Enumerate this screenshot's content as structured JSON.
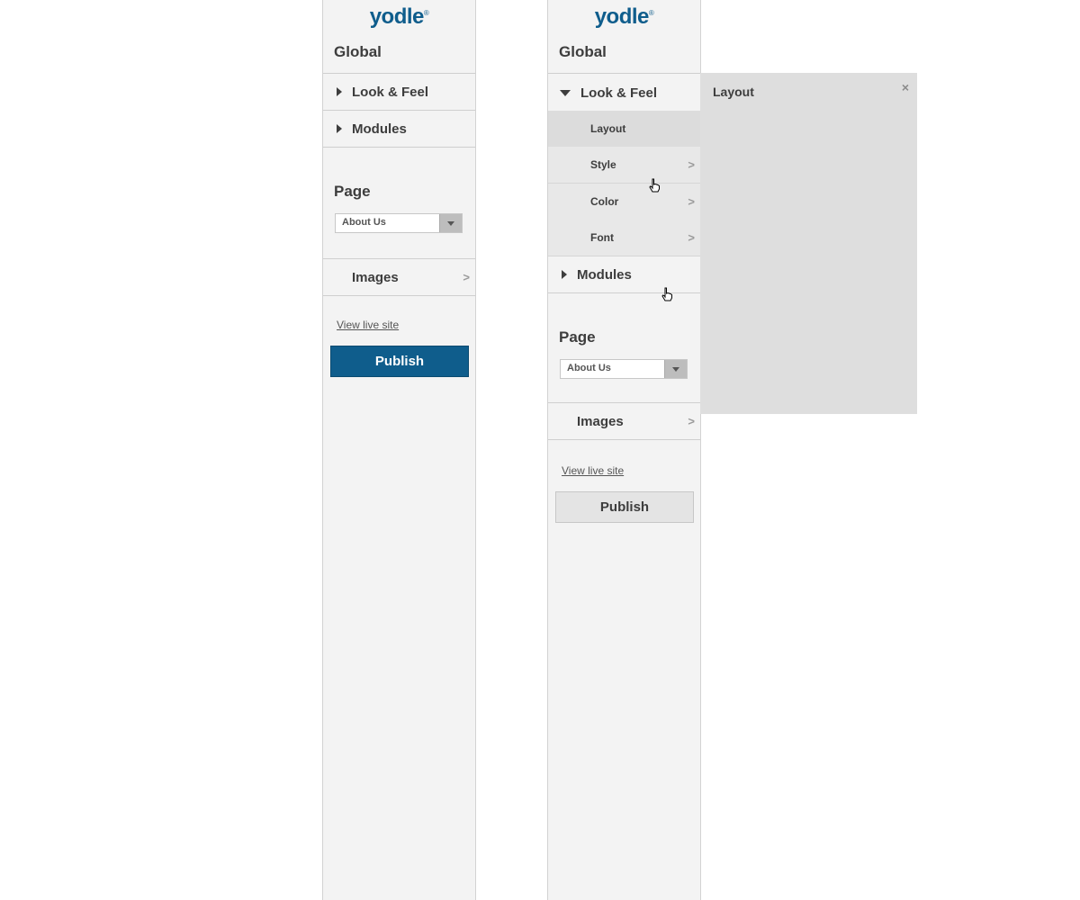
{
  "colors": {
    "brand": "#0f5d8c",
    "sidebar_bg": "#f3f3f3",
    "flyout_bg": "#dedede",
    "text": "#3d3d3d"
  },
  "left_panel": {
    "logo": "yodle",
    "logo_mark": "®",
    "global_label": "Global",
    "sections": [
      {
        "label": "Look & Feel",
        "expanded": false
      },
      {
        "label": "Modules",
        "expanded": false
      }
    ],
    "page_label": "Page",
    "page_select": {
      "value": "About Us"
    },
    "images_label": "Images",
    "view_live_site": "View live site",
    "publish_label": "Publish"
  },
  "right_panel": {
    "logo": "yodle",
    "logo_mark": "®",
    "global_label": "Global",
    "sections": [
      {
        "label": "Look & Feel",
        "expanded": true
      },
      {
        "label": "Modules",
        "expanded": false
      }
    ],
    "look_feel_items": [
      {
        "label": "Layout",
        "active": true
      },
      {
        "label": "Style",
        "active": false
      },
      {
        "label": "Color",
        "active": false
      },
      {
        "label": "Font",
        "active": false
      }
    ],
    "page_label": "Page",
    "page_select": {
      "value": "About Us"
    },
    "images_label": "Images",
    "view_live_site": "View live site",
    "publish_label": "Publish"
  },
  "flyout": {
    "title": "Layout",
    "close_symbol": "×"
  },
  "icons": {
    "caret_right": "caret-right-icon",
    "caret_down": "caret-down-icon",
    "chevron": "chevron-right-icon",
    "close": "close-icon",
    "cursor": "hand-pointer-icon"
  }
}
